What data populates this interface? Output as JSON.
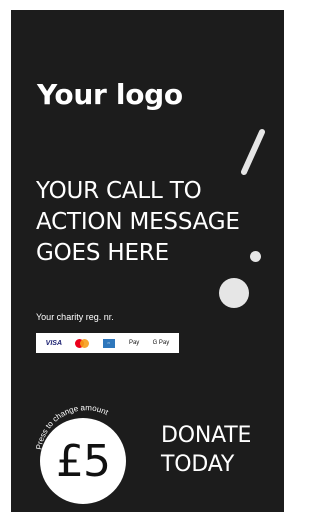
{
  "logo": {
    "text": "Your logo"
  },
  "cta": {
    "line1": "YOUR CALL TO",
    "line2": "ACTION MESSAGE",
    "line3": "GOES HERE"
  },
  "charity": {
    "text": "Your charity reg. nr."
  },
  "payments": {
    "visa": "VISA",
    "mastercard_icon": "mastercard-icon",
    "amex_icon": "amex-icon",
    "apple_pay": "Pay",
    "google_pay": "G Pay"
  },
  "amount": {
    "hint": "Press to change amount",
    "value": "£5"
  },
  "donate": {
    "line1": "DONATE",
    "line2": "TODAY"
  },
  "colors": {
    "background": "#1c1c1c",
    "text": "#ffffff",
    "circle": "#ffffff",
    "circle_text": "#111111"
  }
}
